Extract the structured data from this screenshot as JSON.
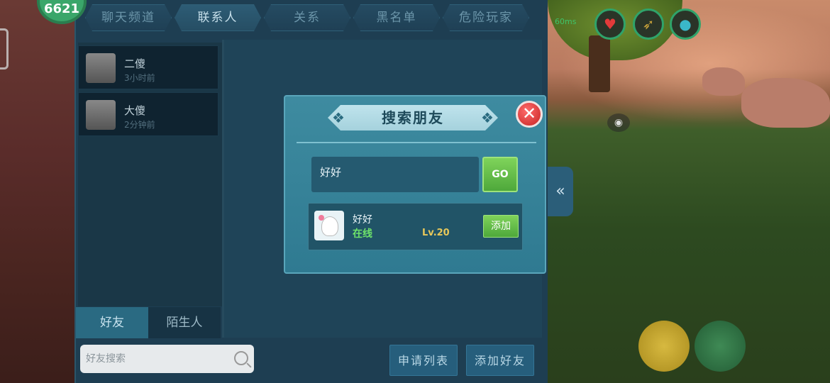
{
  "hud": {
    "level_badge": "6621",
    "wifi_label": "60ms"
  },
  "tabs": [
    {
      "label": "聊天频道",
      "active": false
    },
    {
      "label": "联系人",
      "active": true
    },
    {
      "label": "关系",
      "active": false
    },
    {
      "label": "黑名单",
      "active": false
    },
    {
      "label": "危险玩家",
      "active": false
    }
  ],
  "contacts": [
    {
      "name": "二傻",
      "time": "3小时前"
    },
    {
      "name": "大傻",
      "time": "2分钟前"
    }
  ],
  "bottom_tabs": {
    "friends": "好友",
    "strangers": "陌生人"
  },
  "friend_search": {
    "placeholder": "好友搜索"
  },
  "buttons": {
    "request_list": "申请列表",
    "add_friend": "添加好友"
  },
  "dialog": {
    "title": "搜索朋友",
    "close": "✕",
    "input_value": "好好",
    "go_label": "GO",
    "result": {
      "name": "好好",
      "status": "在线",
      "level": "Lv.20",
      "add_label": "添加"
    }
  },
  "colors": {
    "accent_green": "#4ea83b",
    "close_red": "#c62323",
    "online_green": "#6ee36a",
    "level_gold": "#e8c85a"
  }
}
